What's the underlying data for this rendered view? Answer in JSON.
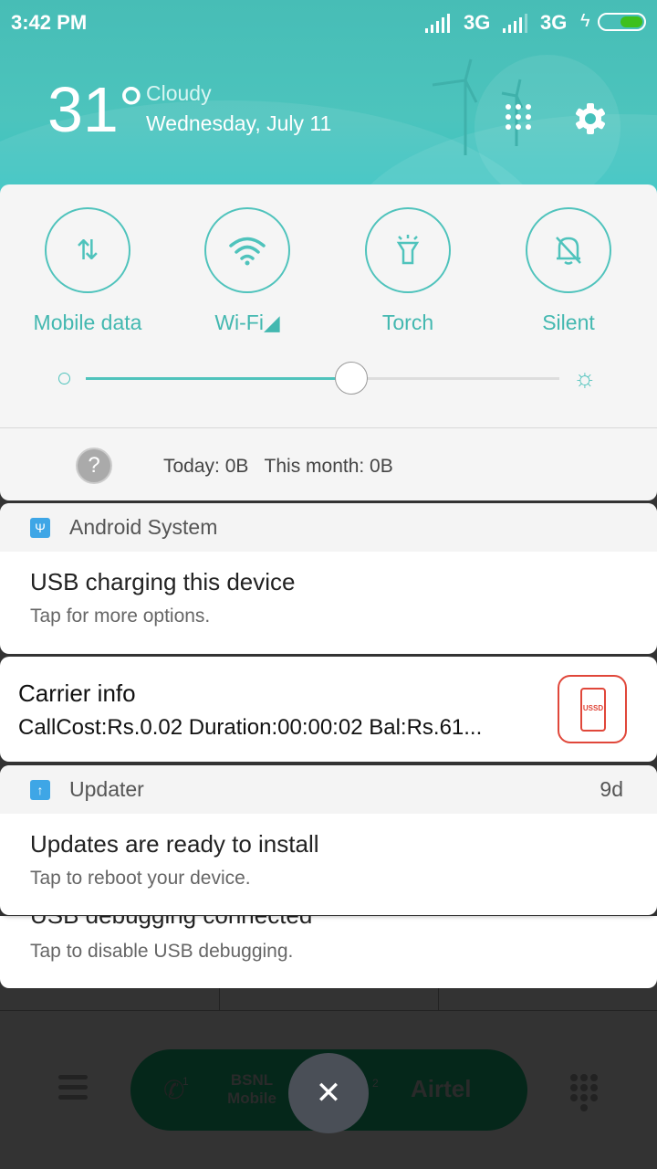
{
  "status_bar": {
    "time": "3:42 PM",
    "network1": "3G",
    "network2": "3G",
    "battery_level": 0.6
  },
  "weather": {
    "temperature": "31°",
    "condition": "Cloudy",
    "date": "Wednesday, July 11"
  },
  "quick_settings": {
    "tiles": [
      {
        "label": "Mobile data"
      },
      {
        "label": "Wi-Fi◢"
      },
      {
        "label": "Torch"
      },
      {
        "label": "Silent"
      }
    ],
    "brightness": 0.56
  },
  "data_usage": {
    "text": "Today: 0B   This month: 0B"
  },
  "notifications": [
    {
      "app": "Android System",
      "title": "USB charging this device",
      "text": "Tap for more options."
    },
    {
      "title": "Carrier info",
      "text": "CallCost:Rs.0.02 Duration:00:00:02 Bal:Rs.61...",
      "icon_label": "USSD"
    },
    {
      "app": "Updater",
      "time": "9d",
      "title": "Updates are ready to install",
      "text": "Tap to reboot your device."
    },
    {
      "title": "USB debugging connected",
      "text": "Tap to disable USB debugging."
    }
  ],
  "dialer": {
    "sim1": "BSNL Mobile",
    "sim1_num": "1",
    "sim2": "Airtel",
    "sim2_num": "2"
  },
  "colors": {
    "accent": "#4fc3bc",
    "ussd": "#e0473a",
    "battery": "#3ec01c"
  }
}
